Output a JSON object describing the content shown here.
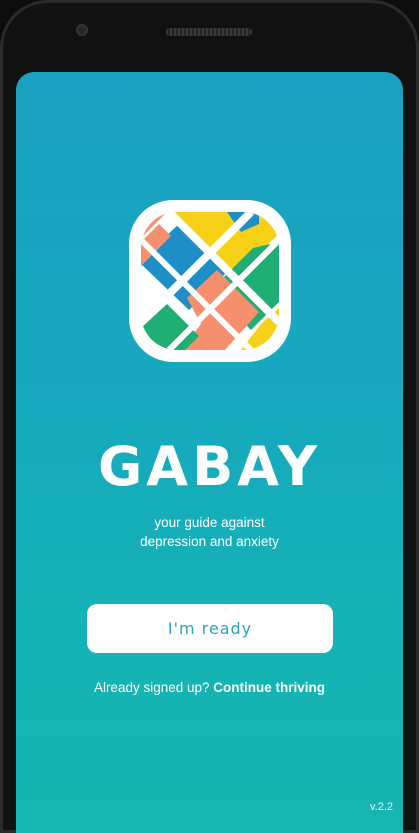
{
  "app": {
    "brand": "GABAY",
    "tagline_line1": "your guide against",
    "tagline_line2": "depression and anxiety",
    "ready_label": "I'm ready",
    "signin_prefix": "Already signed up?",
    "signin_link": "Continue thriving",
    "version": "v.2.2"
  },
  "colors": {
    "background_top": "#1aa0c0",
    "background_bottom": "#16b5ae",
    "button_text": "#2aa3bf",
    "logo_yellow": "#f7d117",
    "logo_blue": "#1e8fc6",
    "logo_green": "#1fae73",
    "logo_salmon": "#f58f6e"
  },
  "icons": [
    "camera-icon",
    "gabay-logo-icon"
  ]
}
